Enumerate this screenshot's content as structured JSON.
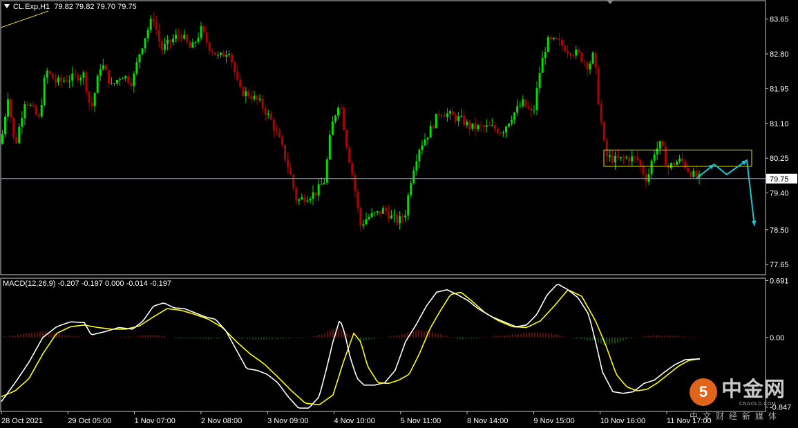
{
  "header": {
    "symbol": "CL.Exp,H1",
    "ohlc": "79.82 79.82 79.70 79.75"
  },
  "macd": {
    "label": "MACD(12,26,9) -0.207 -0.197 0.000 -0.014 -0.197"
  },
  "watermark": {
    "logo": "5",
    "brand": "中金网",
    "url": "CNGOLD.COM",
    "sub": "中文财经新媒体"
  },
  "colors": {
    "bull": "#00e000",
    "bear": "#b00000",
    "macd_main": "#ffffff",
    "macd_signal": "#ffff00",
    "hist_pos": "#a01818",
    "hist_neg": "#1f7a1f",
    "annotation": "#18c6d8",
    "box": "#e0e000",
    "price_line": "#9aa0a8",
    "grid_border": "#c8c8c8"
  },
  "chart_data": [
    {
      "type": "candlestick",
      "price_axis_labels": [
        "83.65",
        "82.80",
        "81.95",
        "81.10",
        "80.25",
        "79.40",
        "78.50",
        "77.65"
      ],
      "ylim": [
        77.4,
        84.1
      ],
      "current_price_label": "79.75",
      "current_price": 79.75,
      "x_labels": [
        "28 Oct 2021",
        "29 Oct 05:00",
        "1 Nov 07:00",
        "2 Nov 08:00",
        "3 Nov 09:00",
        "4 Nov 10:00",
        "5 Nov 11:00",
        "8 Nov 14:00",
        "9 Nov 15:00",
        "10 Nov 16:00",
        "11 Nov 17:00"
      ],
      "close_path": [
        [
          0,
          80.6
        ],
        [
          10,
          81.8
        ],
        [
          20,
          80.5
        ],
        [
          35,
          81.7
        ],
        [
          55,
          81.2
        ],
        [
          65,
          82.4
        ],
        [
          80,
          82.1
        ],
        [
          100,
          82.2
        ],
        [
          120,
          82.3
        ],
        [
          130,
          81.4
        ],
        [
          145,
          82.6
        ],
        [
          160,
          82.0
        ],
        [
          175,
          82.3
        ],
        [
          190,
          82.1
        ],
        [
          200,
          82.8
        ],
        [
          210,
          83.3
        ],
        [
          220,
          83.7
        ],
        [
          232,
          82.9
        ],
        [
          245,
          83.1
        ],
        [
          260,
          83.3
        ],
        [
          275,
          82.9
        ],
        [
          290,
          83.4
        ],
        [
          300,
          83.0
        ],
        [
          315,
          82.7
        ],
        [
          330,
          82.9
        ],
        [
          345,
          81.9
        ],
        [
          360,
          81.8
        ],
        [
          375,
          81.6
        ],
        [
          390,
          81.2
        ],
        [
          405,
          80.6
        ],
        [
          418,
          79.9
        ],
        [
          428,
          79.2
        ],
        [
          440,
          79.3
        ],
        [
          455,
          79.4
        ],
        [
          468,
          79.7
        ],
        [
          478,
          81.0
        ],
        [
          490,
          81.7
        ],
        [
          500,
          80.6
        ],
        [
          510,
          79.7
        ],
        [
          520,
          78.6
        ],
        [
          530,
          78.8
        ],
        [
          545,
          78.9
        ],
        [
          555,
          79.0
        ],
        [
          565,
          78.8
        ],
        [
          575,
          78.7
        ],
        [
          585,
          78.9
        ],
        [
          595,
          79.9
        ],
        [
          605,
          80.5
        ],
        [
          620,
          80.9
        ],
        [
          635,
          81.4
        ],
        [
          650,
          81.3
        ],
        [
          665,
          81.2
        ],
        [
          680,
          81.0
        ],
        [
          695,
          81.0
        ],
        [
          710,
          81.0
        ],
        [
          725,
          80.9
        ],
        [
          740,
          81.3
        ],
        [
          755,
          81.6
        ],
        [
          770,
          81.3
        ],
        [
          780,
          82.4
        ],
        [
          790,
          83.1
        ],
        [
          805,
          83.1
        ],
        [
          820,
          82.9
        ],
        [
          835,
          82.8
        ],
        [
          850,
          82.5
        ],
        [
          858,
          82.8
        ],
        [
          865,
          81.6
        ],
        [
          875,
          80.3
        ],
        [
          890,
          80.2
        ],
        [
          905,
          80.25
        ],
        [
          920,
          80.25
        ],
        [
          935,
          79.7
        ],
        [
          945,
          80.4
        ],
        [
          955,
          80.6
        ],
        [
          965,
          80.0
        ],
        [
          975,
          80.15
        ],
        [
          985,
          80.2
        ],
        [
          995,
          79.95
        ],
        [
          1005,
          79.8
        ],
        [
          1012,
          79.75
        ]
      ],
      "range_box": {
        "top": 80.45,
        "bottom": 80.05
      },
      "projection_path": [
        [
          80.0,
          79.75
        ],
        [
          80.07,
          80.1
        ],
        [
          80.12,
          79.85
        ],
        [
          80.2,
          80.2
        ],
        [
          80.23,
          78.6
        ]
      ],
      "macd": {
        "axis_labels": [
          "0.691",
          "0.00",
          "-0.847"
        ],
        "ylim": [
          -0.9,
          0.72
        ],
        "main": [
          [
            0,
            -0.78
          ],
          [
            20,
            -0.55
          ],
          [
            40,
            -0.3
          ],
          [
            60,
            0.0
          ],
          [
            80,
            0.13
          ],
          [
            100,
            0.19
          ],
          [
            120,
            0.18
          ],
          [
            130,
            0.03
          ],
          [
            150,
            0.07
          ],
          [
            170,
            0.12
          ],
          [
            190,
            0.1
          ],
          [
            205,
            0.2
          ],
          [
            220,
            0.38
          ],
          [
            235,
            0.42
          ],
          [
            250,
            0.36
          ],
          [
            265,
            0.35
          ],
          [
            280,
            0.3
          ],
          [
            295,
            0.25
          ],
          [
            310,
            0.22
          ],
          [
            325,
            0.08
          ],
          [
            340,
            -0.15
          ],
          [
            355,
            -0.38
          ],
          [
            370,
            -0.4
          ],
          [
            385,
            -0.45
          ],
          [
            400,
            -0.55
          ],
          [
            415,
            -0.72
          ],
          [
            430,
            -0.86
          ],
          [
            445,
            -0.86
          ],
          [
            460,
            -0.72
          ],
          [
            470,
            -0.4
          ],
          [
            480,
            -0.05
          ],
          [
            490,
            0.22
          ],
          [
            497,
            0.05
          ],
          [
            505,
            -0.25
          ],
          [
            515,
            -0.5
          ],
          [
            525,
            -0.58
          ],
          [
            540,
            -0.58
          ],
          [
            555,
            -0.55
          ],
          [
            570,
            -0.4
          ],
          [
            585,
            -0.05
          ],
          [
            600,
            0.15
          ],
          [
            615,
            0.38
          ],
          [
            630,
            0.55
          ],
          [
            645,
            0.58
          ],
          [
            660,
            0.52
          ],
          [
            675,
            0.45
          ],
          [
            690,
            0.35
          ],
          [
            710,
            0.25
          ],
          [
            730,
            0.18
          ],
          [
            745,
            0.13
          ],
          [
            760,
            0.15
          ],
          [
            775,
            0.28
          ],
          [
            790,
            0.52
          ],
          [
            805,
            0.65
          ],
          [
            820,
            0.58
          ],
          [
            835,
            0.48
          ],
          [
            850,
            0.28
          ],
          [
            860,
            -0.05
          ],
          [
            870,
            -0.42
          ],
          [
            885,
            -0.66
          ],
          [
            900,
            -0.68
          ],
          [
            915,
            -0.66
          ],
          [
            930,
            -0.56
          ],
          [
            945,
            -0.52
          ],
          [
            960,
            -0.42
          ],
          [
            975,
            -0.33
          ],
          [
            990,
            -0.27
          ],
          [
            1012,
            -0.26
          ]
        ],
        "signal": [
          [
            0,
            -0.72
          ],
          [
            20,
            -0.65
          ],
          [
            40,
            -0.5
          ],
          [
            60,
            -0.2
          ],
          [
            80,
            0.05
          ],
          [
            100,
            0.13
          ],
          [
            120,
            0.15
          ],
          [
            140,
            0.12
          ],
          [
            160,
            0.1
          ],
          [
            180,
            0.1
          ],
          [
            200,
            0.14
          ],
          [
            220,
            0.25
          ],
          [
            240,
            0.35
          ],
          [
            260,
            0.33
          ],
          [
            280,
            0.28
          ],
          [
            300,
            0.22
          ],
          [
            320,
            0.12
          ],
          [
            340,
            -0.05
          ],
          [
            360,
            -0.2
          ],
          [
            380,
            -0.32
          ],
          [
            400,
            -0.48
          ],
          [
            420,
            -0.65
          ],
          [
            440,
            -0.8
          ],
          [
            460,
            -0.82
          ],
          [
            480,
            -0.7
          ],
          [
            495,
            -0.3
          ],
          [
            510,
            0.05
          ],
          [
            520,
            -0.05
          ],
          [
            530,
            -0.35
          ],
          [
            545,
            -0.55
          ],
          [
            560,
            -0.56
          ],
          [
            575,
            -0.52
          ],
          [
            590,
            -0.45
          ],
          [
            605,
            -0.2
          ],
          [
            620,
            0.1
          ],
          [
            635,
            0.32
          ],
          [
            650,
            0.52
          ],
          [
            665,
            0.55
          ],
          [
            680,
            0.45
          ],
          [
            700,
            0.3
          ],
          [
            720,
            0.2
          ],
          [
            740,
            0.13
          ],
          [
            760,
            0.12
          ],
          [
            780,
            0.2
          ],
          [
            800,
            0.38
          ],
          [
            820,
            0.58
          ],
          [
            840,
            0.5
          ],
          [
            860,
            0.2
          ],
          [
            875,
            -0.1
          ],
          [
            890,
            -0.45
          ],
          [
            905,
            -0.6
          ],
          [
            920,
            -0.65
          ],
          [
            935,
            -0.63
          ],
          [
            950,
            -0.55
          ],
          [
            965,
            -0.45
          ],
          [
            980,
            -0.35
          ],
          [
            995,
            -0.28
          ],
          [
            1012,
            -0.26
          ]
        ],
        "histogram": [
          [
            8,
            0.05
          ],
          [
            20,
            0.12
          ],
          [
            35,
            0.22
          ],
          [
            50,
            0.32
          ],
          [
            62,
            0.42
          ],
          [
            75,
            0.3
          ],
          [
            90,
            0.18
          ],
          [
            105,
            0.1
          ],
          [
            120,
            0.04
          ],
          [
            135,
            -0.04
          ],
          [
            150,
            -0.02
          ],
          [
            165,
            0.02
          ],
          [
            180,
            0.04
          ],
          [
            195,
            0.07
          ],
          [
            210,
            0.12
          ],
          [
            225,
            0.2
          ],
          [
            240,
            0.05
          ],
          [
            255,
            -0.05
          ],
          [
            270,
            -0.08
          ],
          [
            285,
            -0.1
          ],
          [
            300,
            -0.12
          ],
          [
            315,
            -0.06
          ],
          [
            330,
            -0.03
          ],
          [
            345,
            -0.08
          ],
          [
            360,
            -0.1
          ],
          [
            375,
            -0.12
          ],
          [
            390,
            -0.1
          ],
          [
            405,
            -0.09
          ],
          [
            420,
            -0.06
          ],
          [
            435,
            -0.05
          ],
          [
            450,
            0.0
          ],
          [
            460,
            0.12
          ],
          [
            470,
            0.3
          ],
          [
            480,
            0.55
          ],
          [
            490,
            0.65
          ],
          [
            500,
            0.38
          ],
          [
            510,
            -0.1
          ],
          [
            520,
            -0.25
          ],
          [
            530,
            -0.2
          ],
          [
            545,
            -0.05
          ],
          [
            560,
            0.04
          ],
          [
            575,
            0.1
          ],
          [
            590,
            0.32
          ],
          [
            605,
            0.5
          ],
          [
            620,
            0.42
          ],
          [
            635,
            0.25
          ],
          [
            650,
            0.05
          ],
          [
            665,
            -0.12
          ],
          [
            680,
            -0.1
          ],
          [
            695,
            -0.05
          ],
          [
            710,
            0.05
          ],
          [
            725,
            0.12
          ],
          [
            740,
            0.18
          ],
          [
            755,
            0.25
          ],
          [
            770,
            0.35
          ],
          [
            785,
            0.3
          ],
          [
            800,
            0.25
          ],
          [
            815,
            0.08
          ],
          [
            830,
            -0.05
          ],
          [
            845,
            -0.12
          ],
          [
            860,
            -0.25
          ],
          [
            875,
            -0.5
          ],
          [
            890,
            -0.4
          ],
          [
            905,
            -0.15
          ],
          [
            920,
            0.0
          ],
          [
            935,
            0.12
          ],
          [
            950,
            0.15
          ],
          [
            965,
            0.1
          ],
          [
            980,
            0.08
          ],
          [
            995,
            0.04
          ],
          [
            1012,
            0.0
          ]
        ]
      }
    }
  ]
}
